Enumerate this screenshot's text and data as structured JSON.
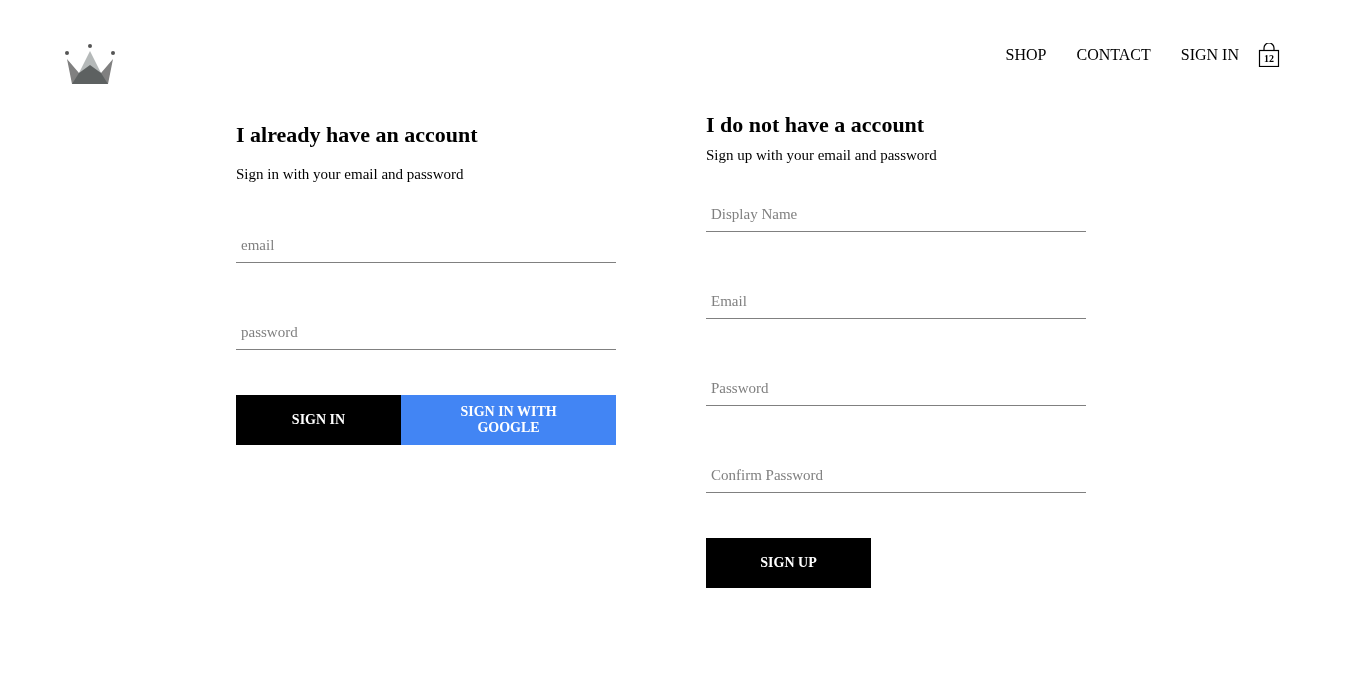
{
  "nav": {
    "links": [
      "SHOP",
      "CONTACT",
      "SIGN IN"
    ],
    "cart_count": "12"
  },
  "sign_in": {
    "title": "I already have an account",
    "subtitle": "Sign in with your email and password",
    "fields": [
      {
        "placeholder": "email"
      },
      {
        "placeholder": "password"
      }
    ],
    "buttons": [
      {
        "label": "SIGN IN",
        "kind": "primary"
      },
      {
        "label": "SIGN IN WITH GOOGLE",
        "kind": "google"
      }
    ]
  },
  "sign_up": {
    "title": "I do not have a account",
    "subtitle": "Sign up with your email and password",
    "fields": [
      {
        "placeholder": "Display Name"
      },
      {
        "placeholder": "Email"
      },
      {
        "placeholder": "Password"
      },
      {
        "placeholder": "Confirm Password"
      }
    ],
    "buttons": [
      {
        "label": "SIGN UP",
        "kind": "primary"
      }
    ]
  }
}
